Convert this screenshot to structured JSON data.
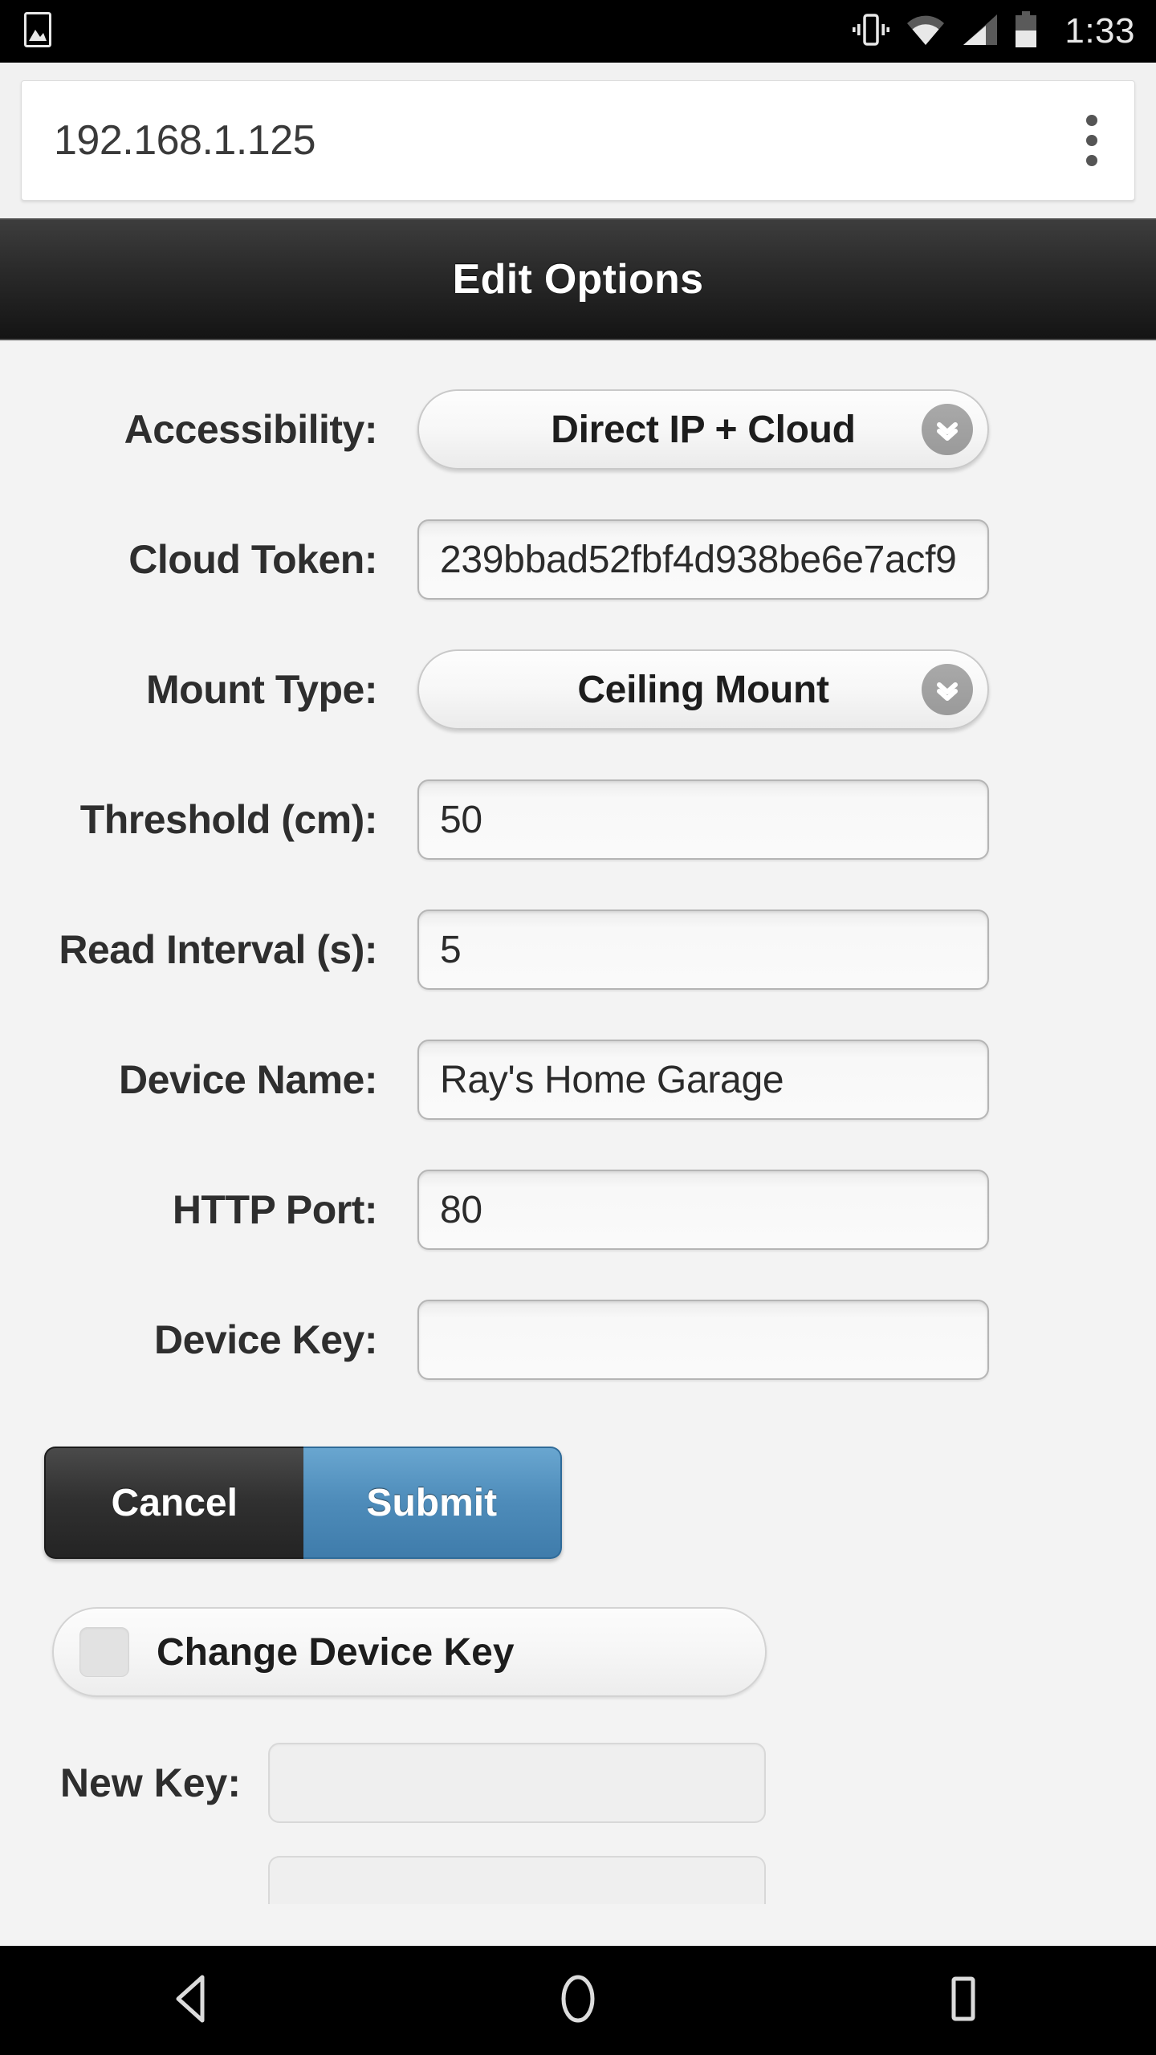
{
  "status_bar": {
    "time": "1:33",
    "icons": [
      "photo-icon",
      "vibrate-icon",
      "wifi-icon",
      "signal-icon",
      "battery-icon"
    ]
  },
  "browser": {
    "url": "192.168.1.125",
    "menu_label": "overflow-menu"
  },
  "header": {
    "title": "Edit Options"
  },
  "form": {
    "rows": [
      {
        "label": "Accessibility:",
        "value": "Direct IP + Cloud",
        "type": "select"
      },
      {
        "label": "Cloud Token:",
        "value": "239bbad52fbf4d938be6e7acf9",
        "type": "text"
      },
      {
        "label": "Mount Type:",
        "value": "Ceiling Mount",
        "type": "select"
      },
      {
        "label": "Threshold (cm):",
        "value": "50",
        "type": "text"
      },
      {
        "label": "Read Interval (s):",
        "value": "5",
        "type": "text"
      },
      {
        "label": "Device Name:",
        "value": "Ray's Home Garage",
        "type": "text"
      },
      {
        "label": "HTTP Port:",
        "value": "80",
        "type": "text"
      },
      {
        "label": "Device Key:",
        "value": "",
        "type": "text"
      }
    ]
  },
  "actions": {
    "cancel_label": "Cancel",
    "submit_label": "Submit"
  },
  "change_key": {
    "label": "Change Device Key",
    "checked": false
  },
  "new_key": {
    "label": "New Key:",
    "value": ""
  },
  "nav_bar": {
    "back": "back-icon",
    "home": "home-icon",
    "recents": "recents-icon"
  },
  "colors": {
    "accent_blue": "#4e8cba",
    "header_dark": "#2b2b2b",
    "page_bg": "#f3f3f3",
    "label_text": "#2e2e2e"
  }
}
